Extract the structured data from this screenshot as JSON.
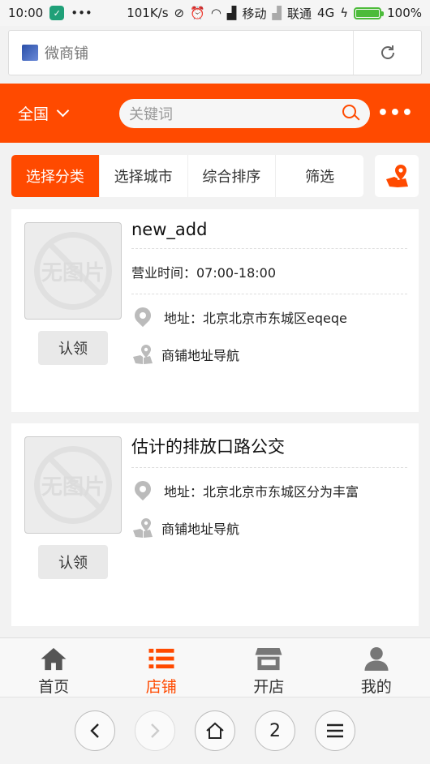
{
  "status_bar": {
    "time": "10:00",
    "network_speed": "101K/s",
    "carrier1": "移动",
    "carrier2": "联通",
    "network_type": "4G",
    "battery": "100%",
    "battery_level": 1.0
  },
  "browser": {
    "page_title": "微商铺",
    "tab_count": "2"
  },
  "header": {
    "region": "全国",
    "search_placeholder": "关键词",
    "more": "•••"
  },
  "filters": [
    "选择分类",
    "选择城市",
    "综合排序",
    "筛选"
  ],
  "stores": [
    {
      "name": "new_add",
      "hours": "营业时间：07:00-18:00",
      "address": "地址：北京北京市东城区eqeqe",
      "nav_label": "商铺地址导航",
      "claim_label": "认领",
      "no_image_text": "无图片"
    },
    {
      "name": "估计的排放口路公交",
      "address": "地址：北京北京市东城区分为丰富",
      "nav_label": "商铺地址导航",
      "claim_label": "认领",
      "no_image_text": "无图片"
    }
  ],
  "tabbar": [
    {
      "label": "首页",
      "icon": "home-icon"
    },
    {
      "label": "店铺",
      "icon": "list-icon"
    },
    {
      "label": "开店",
      "icon": "store-icon"
    },
    {
      "label": "我的",
      "icon": "user-icon"
    }
  ],
  "colors": {
    "brand": "#ff4a00",
    "background": "#f2f2f2"
  }
}
